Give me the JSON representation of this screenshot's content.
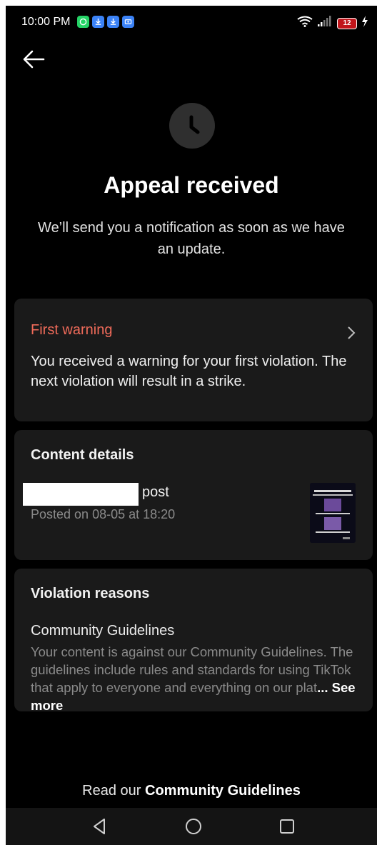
{
  "status_bar": {
    "time": "10:00 PM",
    "battery": "12",
    "notification_icons": [
      "whatsapp-icon",
      "download-icon",
      "download-icon",
      "media-icon"
    ],
    "colors": {
      "whatsapp": "#25d366",
      "download": "#3b82f6",
      "media": "#3b82f6",
      "battery": "#c0151b"
    }
  },
  "header": {
    "title": "Appeal received",
    "subtitle": "We’ll send you a notification as soon as we have an update."
  },
  "warning_card": {
    "title": "First warning",
    "text": "You received a warning for your first violation. The next violation will result in a strike.",
    "accent": "#f06b5a"
  },
  "content_details": {
    "title": "Content details",
    "post_label": "post",
    "posted_on": "Posted on 08-05 at 18:20"
  },
  "violation": {
    "title": "Violation reasons",
    "guideline": "Community Guidelines",
    "description": "Your content is against our Community Guidelines. The guidelines include rules and standards for using TikTok that apply to everyone and everything on our plat",
    "ellipsis": "...",
    "see_more": " See more"
  },
  "footer": {
    "prefix": "Read our ",
    "link": "Community Guidelines"
  }
}
